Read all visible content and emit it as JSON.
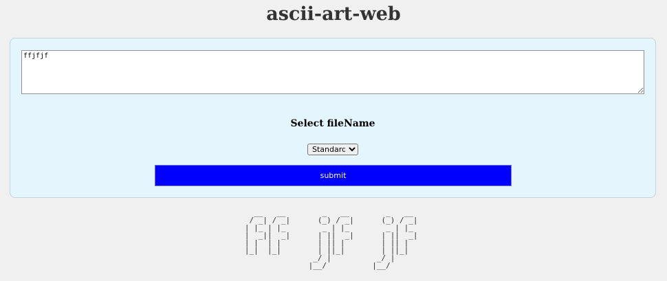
{
  "page": {
    "title": "ascii-art-web"
  },
  "form": {
    "text_input": "ffjfjf",
    "select_label": "Select fileName",
    "file_select": {
      "selected": "Standard",
      "options": [
        "Standard"
      ]
    },
    "submit_label": "submit"
  },
  "output": {
    "ascii_art": "  __   __        _   __        _   __  \n / _| / _|      (_) / _|      (_) / _| \n| |_ | |_        _ | |_        _ | |_  \n|  _||  _|      | ||  _|      | ||  _| \n| |  | |        | || |        | || |   \n|_|  |_|        | ||_|        | ||_|   \n               _/ |          _/ |      \n              |__/          |__/       "
  },
  "colors": {
    "background": "#f0f0f0",
    "panel": "#e5f5fd",
    "submit": "#0000ff"
  }
}
